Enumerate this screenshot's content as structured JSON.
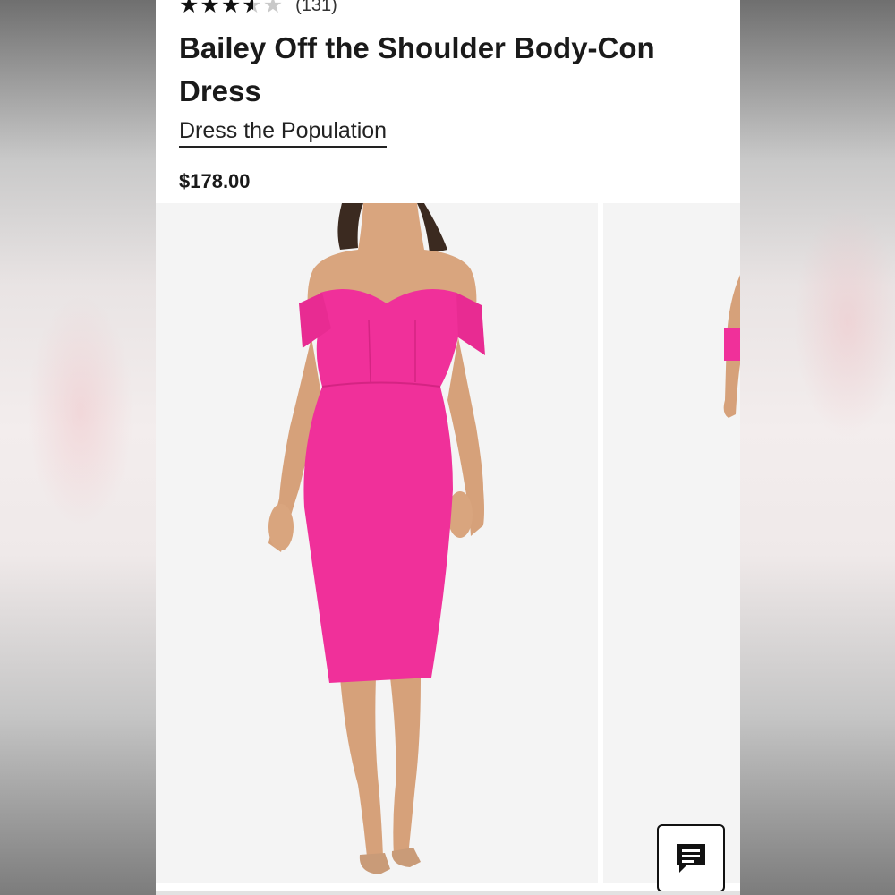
{
  "product": {
    "rating": 3.5,
    "rating_max": 5,
    "review_count": "(131)",
    "title": "Bailey Off the Shoulder Body-Con Dress",
    "brand": "Dress the Population",
    "price": "$178.00"
  },
  "gallery": {
    "images": [
      "product-photo-front",
      "product-photo-side"
    ]
  },
  "icons": {
    "chat": "chat-icon"
  },
  "colors": {
    "dress": "#f0309a",
    "text": "#1a1a1a"
  }
}
